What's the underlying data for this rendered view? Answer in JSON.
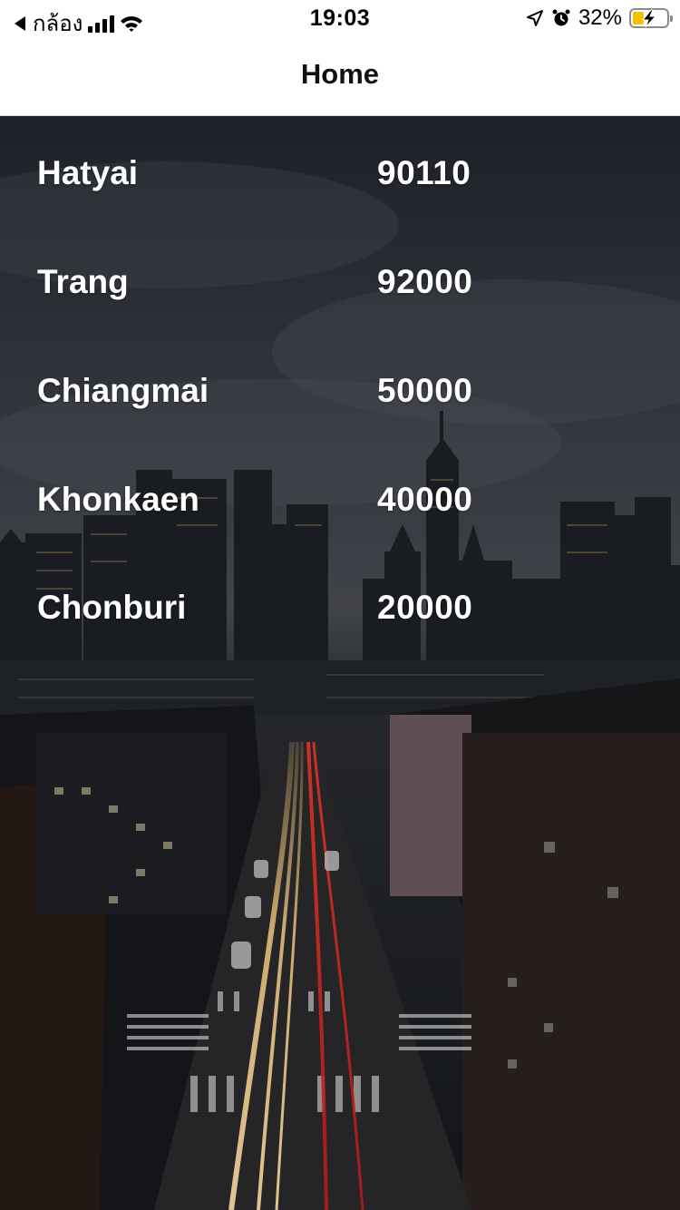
{
  "status_bar": {
    "back_app": "กล้อง",
    "time": "19:03",
    "battery_percent": "32%",
    "battery_level": 0.32,
    "battery_color": "#f2c200"
  },
  "nav": {
    "title": "Home"
  },
  "places": [
    {
      "city": "Hatyai",
      "zip": "90110"
    },
    {
      "city": "Trang",
      "zip": "92000"
    },
    {
      "city": "Chiangmai",
      "zip": "50000"
    },
    {
      "city": "Khonkaen",
      "zip": "40000"
    },
    {
      "city": "Chonburi",
      "zip": "20000"
    }
  ],
  "icons": {
    "back": "back-arrow-icon",
    "signal": "cellular-signal-icon",
    "wifi": "wifi-icon",
    "location": "location-arrow-icon",
    "alarm": "alarm-clock-icon",
    "battery": "battery-charging-icon"
  }
}
